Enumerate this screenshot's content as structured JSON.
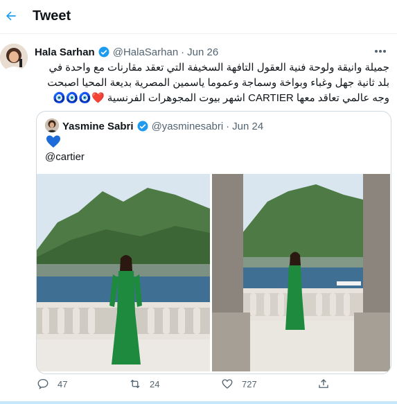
{
  "header": {
    "title": "Tweet"
  },
  "tweet": {
    "display_name": "Hala Sarhan",
    "handle": "@HalaSarhan",
    "separator": "·",
    "date": "Jun 26",
    "text_line1": "جميلة وانيقة ولوحة فنية العقول التافهة السخيفة التي تعقد مقارنات مع واحدة في",
    "text_line2": "بلد ثانية جهل وغباء وبواخة وسماجة وعموما ياسمين المصرية بديعة المحيا اصبحت",
    "text_line3": "وجه عالمي تعاقد معها CARTIER اشهر بيوت المجوهرات الفرنسية ❤️🧿🧿🧿"
  },
  "quote": {
    "display_name": "Yasmine Sabri",
    "handle": "@yasminesabri",
    "separator": "·",
    "date": "Jun 24",
    "text": "@cartier"
  },
  "actions": {
    "reply_count": "47",
    "retweet_count": "24",
    "like_count": "727"
  },
  "colors": {
    "accent": "#1d9bf0",
    "text": "#0f1419",
    "muted": "#536471",
    "border": "#cfd9de",
    "dress": "#1e8a3e"
  },
  "icons": [
    "back-arrow-icon",
    "verified-badge-icon",
    "more-icon",
    "blue-heart-icon",
    "reply-icon",
    "retweet-icon",
    "like-icon",
    "share-icon"
  ]
}
